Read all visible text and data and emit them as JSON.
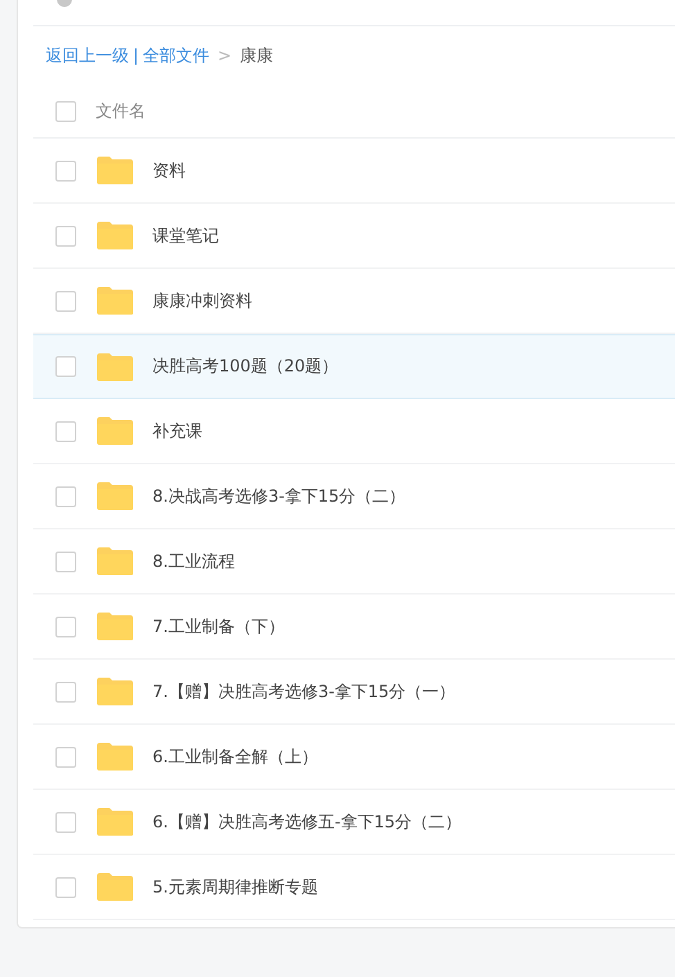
{
  "breadcrumb": {
    "back": "返回上一级",
    "separator": "|",
    "all_files": "全部文件",
    "arrow": ">",
    "current": "康康"
  },
  "table": {
    "header": {
      "label": "文件名",
      "checked": false
    },
    "rows": [
      {
        "name": "资料",
        "checked": false,
        "hovered": false
      },
      {
        "name": "课堂笔记",
        "checked": false,
        "hovered": false
      },
      {
        "name": "康康冲刺资料",
        "checked": false,
        "hovered": false
      },
      {
        "name": "决胜高考100题（20题）",
        "checked": false,
        "hovered": true
      },
      {
        "name": "补充课",
        "checked": false,
        "hovered": false
      },
      {
        "name": "8.决战高考选修3-拿下15分（二）",
        "checked": false,
        "hovered": false
      },
      {
        "name": "8.工业流程",
        "checked": false,
        "hovered": false
      },
      {
        "name": "7.工业制备（下）",
        "checked": false,
        "hovered": false
      },
      {
        "name": "7.【赠】决胜高考选修3-拿下15分（一）",
        "checked": false,
        "hovered": false
      },
      {
        "name": "6.工业制备全解（上）",
        "checked": false,
        "hovered": false
      },
      {
        "name": "6.【赠】决胜高考选修五-拿下15分（二）",
        "checked": false,
        "hovered": false
      },
      {
        "name": "5.元素周期律推断专题",
        "checked": false,
        "hovered": false
      }
    ]
  }
}
